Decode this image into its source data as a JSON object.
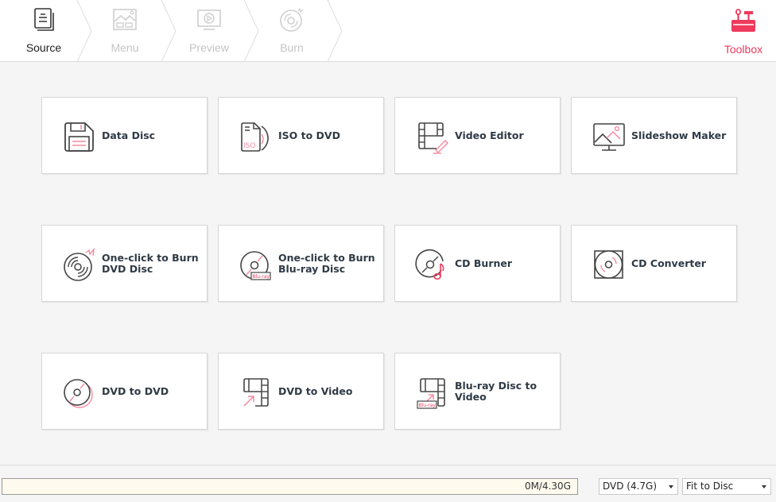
{
  "header": {
    "steps": [
      {
        "label": "Source",
        "icon": "source-documents-icon",
        "state": "active"
      },
      {
        "label": "Menu",
        "icon": "menu-image-icon",
        "state": "inactive"
      },
      {
        "label": "Preview",
        "icon": "preview-play-icon",
        "state": "inactive"
      },
      {
        "label": "Burn",
        "icon": "burn-disc-icon",
        "state": "inactive"
      }
    ],
    "toolbox": {
      "label": "Toolbox",
      "icon": "toolbox-icon",
      "color": "#ee3a5c"
    }
  },
  "tiles": [
    {
      "line1": "Data Disc",
      "line2": "",
      "icon": "floppy-disk-icon"
    },
    {
      "line1": "ISO to DVD",
      "line2": "",
      "icon": "iso-file-icon"
    },
    {
      "line1": "Video Editor",
      "line2": "",
      "icon": "film-edit-icon"
    },
    {
      "line1": "Slideshow Maker",
      "line2": "",
      "icon": "monitor-image-icon"
    },
    {
      "line1": "One-click to Burn",
      "line2": "DVD Disc",
      "icon": "burn-dvd-icon"
    },
    {
      "line1": "One-click to Burn",
      "line2": "Blu-ray Disc",
      "icon": "bluray-disc-icon"
    },
    {
      "line1": "CD Burner",
      "line2": "",
      "icon": "cd-music-icon"
    },
    {
      "line1": "CD Converter",
      "line2": "",
      "icon": "cd-case-icon"
    },
    {
      "line1": "DVD to DVD",
      "line2": "",
      "icon": "dvd-copy-icon"
    },
    {
      "line1": "DVD to Video",
      "line2": "",
      "icon": "dvd-to-video-icon"
    },
    {
      "line1": "Blu-ray Disc to Video",
      "line2": "",
      "icon": "bluray-to-video-icon"
    }
  ],
  "icon_text": {
    "iso": "ISO",
    "bluray": "Blu-ray"
  },
  "footer": {
    "capacity_text": "0M/4.30G",
    "capacity_used_fraction": 0,
    "disc_type": "DVD (4.7G)",
    "quality_mode": "Fit to Disc"
  },
  "colors": {
    "accent": "#ee3a5c",
    "accent_light": "#f58aa0",
    "icon_dark": "#444444"
  }
}
